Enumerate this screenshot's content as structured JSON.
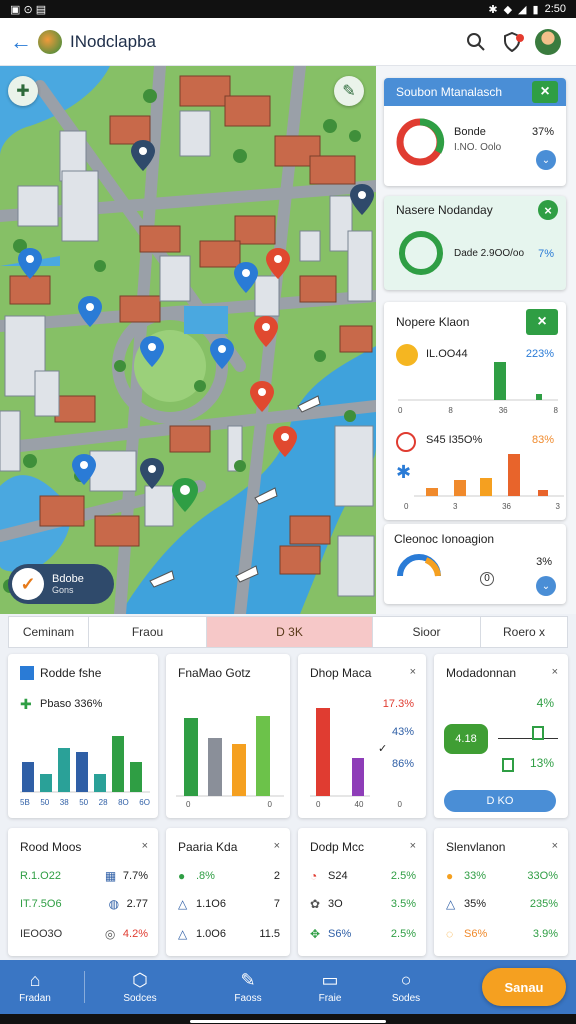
{
  "status": {
    "time": "2:50",
    "left_icons": "▣ ⊙ ▤"
  },
  "appbar": {
    "title": "INodclapba",
    "back_icon": "arrow-left-icon",
    "search_icon": "search-icon",
    "notif_icon": "shield-icon"
  },
  "map": {
    "badge_title": "Bdobe",
    "badge_sub": "Gons"
  },
  "cards": {
    "c1": {
      "title": "Soubon Mtanalasch",
      "label": "Bonde",
      "sub": "I.NO. Oolo",
      "value": "37%"
    },
    "c2": {
      "title": "Nasere Nodanday",
      "label": "Dade 2.9OO/oo",
      "value": "7%"
    },
    "c3": {
      "title": "Nopere Klaon",
      "row1_label": "IL.OO44",
      "row1_value": "223%",
      "row1_ticks": [
        "0",
        "8",
        "36",
        "8"
      ],
      "row2_label": "S45 I35O%",
      "row2_value": "83%",
      "row2_ticks": [
        "0",
        "3",
        "36",
        "3"
      ]
    },
    "c4": {
      "title": "Cleonoc Ionoagion",
      "value": "3%",
      "sub": "0"
    }
  },
  "tabs": [
    "Ceminam",
    "Fraou",
    "D 3K",
    "Sioor",
    "Roero x"
  ],
  "panels": {
    "p1": {
      "title": "Rodde fshe",
      "sub": "Pbaso 336%",
      "ticks": [
        "5B",
        "50",
        "38",
        "50",
        "28",
        "8O",
        "6O"
      ]
    },
    "p2": {
      "title": "FnaMao Gotz",
      "ticks": [
        "0",
        "0"
      ]
    },
    "p3": {
      "title": "Dhop Maca",
      "close": "×",
      "values": [
        "17.3%",
        "43%",
        "86%"
      ],
      "ticks": [
        "0",
        "40",
        "0"
      ]
    },
    "p4": {
      "title": "Modadonnan",
      "close": "×",
      "values": [
        "4%",
        "13%"
      ],
      "button": "D KO",
      "chip": "4.18"
    }
  },
  "metrics": {
    "m1": {
      "title": "Rood Moos",
      "close": "×",
      "rows": [
        [
          "R.1.O22",
          "7.7%"
        ],
        [
          "IT.7.5O6",
          "2.77"
        ],
        [
          "IEOO3O",
          "4.2%"
        ]
      ]
    },
    "m2": {
      "title": "Paaria Kda",
      "close": "×",
      "rows": [
        [
          ".8%",
          "2"
        ],
        [
          "1.1O6",
          "7"
        ],
        [
          "1.0O6",
          "11.5"
        ]
      ]
    },
    "m3": {
      "title": "Dodp Mcc",
      "close": "×",
      "rows": [
        [
          "S24",
          "2.5%"
        ],
        [
          "3O",
          "3.5%"
        ],
        [
          "S6%",
          "2.5%"
        ]
      ]
    },
    "m4": {
      "title": "Slenvlanon",
      "close": "×",
      "rows": [
        [
          "33%",
          "33O%"
        ],
        [
          "35%",
          "235%"
        ],
        [
          "S6%",
          "3.9%"
        ]
      ]
    }
  },
  "nav": [
    {
      "label": "Fradan",
      "icon": "home-icon"
    },
    {
      "label": "Sodces",
      "icon": "shield-icon"
    },
    {
      "label": "Faoss",
      "icon": "pen-icon"
    },
    {
      "label": "Fraie",
      "icon": "chat-icon"
    },
    {
      "label": "Sodes",
      "icon": "circle-icon"
    }
  ],
  "fab": {
    "label": "Sanau"
  },
  "colors": {
    "accent": "#3a76c4",
    "green": "#2f9e44",
    "orange": "#f08a2c",
    "red": "#e03c31",
    "blue": "#2a7bd6"
  }
}
